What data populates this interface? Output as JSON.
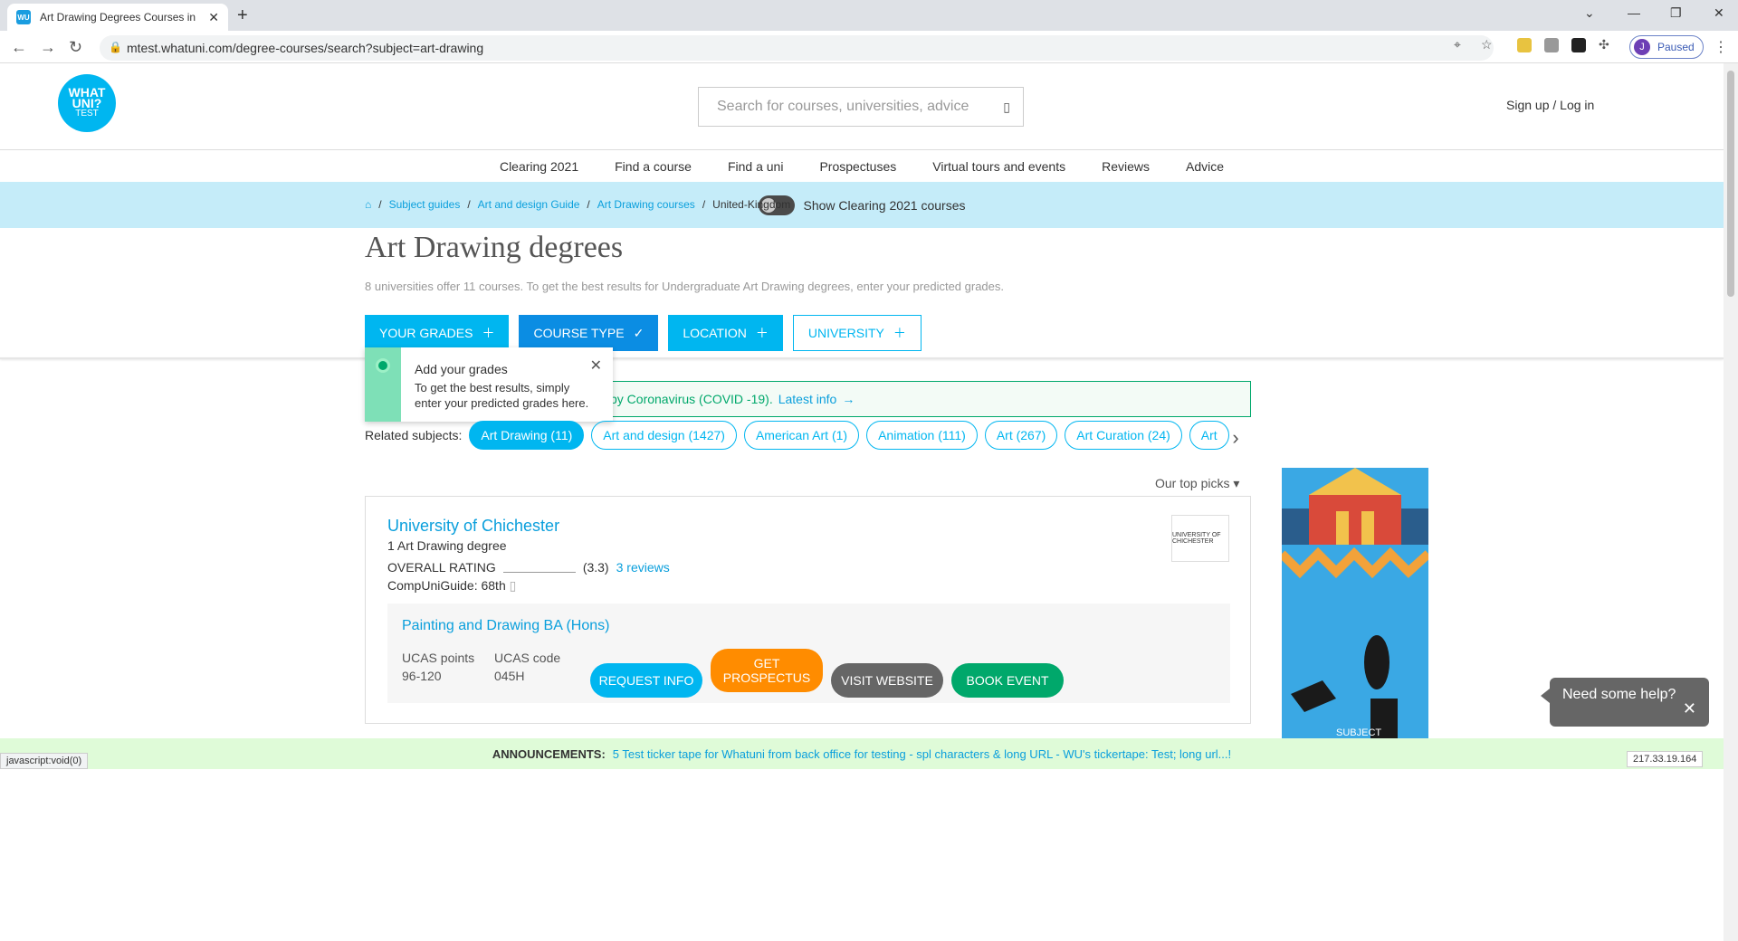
{
  "browser": {
    "tab_title": "Art Drawing Degrees Courses in",
    "url": "mtest.whatuni.com/degree-courses/search?subject=art-drawing",
    "profile_initial": "J",
    "profile_status": "Paused"
  },
  "header": {
    "logo_line1": "WHAT",
    "logo_line2": "UNI?",
    "logo_line3": "TEST",
    "search_placeholder": "Search for courses, universities, advice",
    "signin": "Sign up / Log in"
  },
  "nav": [
    "Clearing 2021",
    "Find a course",
    "Find a uni",
    "Prospectuses",
    "Virtual tours and events",
    "Reviews",
    "Advice"
  ],
  "clearing_toggle": "Show Clearing 2021 courses",
  "breadcrumb": [
    "Subject guides",
    "Art and design Guide",
    "Art Drawing courses",
    "United-Kingdom"
  ],
  "title": "Art Drawing degrees",
  "subtitle": "8 universities offer 11 courses. To get the best results for Undergraduate Art Drawing degrees, enter your predicted grades.",
  "filters": [
    "YOUR GRADES",
    "COURSE TYPE",
    "LOCATION",
    "UNIVERSITY"
  ],
  "covid": {
    "text": "by Coronavirus (COVID -19).",
    "link": "Latest info"
  },
  "tooltip": {
    "title": "Add your grades",
    "text": "To get the best results, simply enter your predicted grades here."
  },
  "related": {
    "label": "Related subjects:",
    "chips": [
      "Art Drawing (11)",
      "Art and design (1427)",
      "American Art (1)",
      "Animation (111)",
      "Art (267)",
      "Art Curation (24)",
      "Art"
    ]
  },
  "sort": "Our top picks",
  "result": {
    "uni": "University of Chichester",
    "count": "1 Art Drawing degree",
    "rating_label": "OVERALL RATING",
    "rating_value": "(3.3)",
    "reviews": "3 reviews",
    "cug": "CompUniGuide: 68th",
    "logo_text": "UNIVERSITY OF CHICHESTER",
    "course": "Painting and Drawing BA (Hons)",
    "ucas_points_label": "UCAS points",
    "ucas_points": "96-120",
    "ucas_code_label": "UCAS code",
    "ucas_code": "045H",
    "buttons": [
      "REQUEST INFO",
      "GET PROSPECTUS",
      "VISIT WEBSITE",
      "BOOK EVENT"
    ]
  },
  "ad_text": "SUBJECT",
  "help": "Need some help?",
  "announcement": {
    "label": "ANNOUNCEMENTS:",
    "text": "5 Test ticker tape for Whatuni from back office for testing - spl characters & long URL - WU's tickertape: Test; long url...!"
  },
  "status": "javascript:void(0)",
  "ip": "217.33.19.164",
  "colors": {
    "brand": "#00b6f0",
    "green": "#00a86b",
    "orange": "#ff8c00",
    "grey_btn": "#666666"
  }
}
